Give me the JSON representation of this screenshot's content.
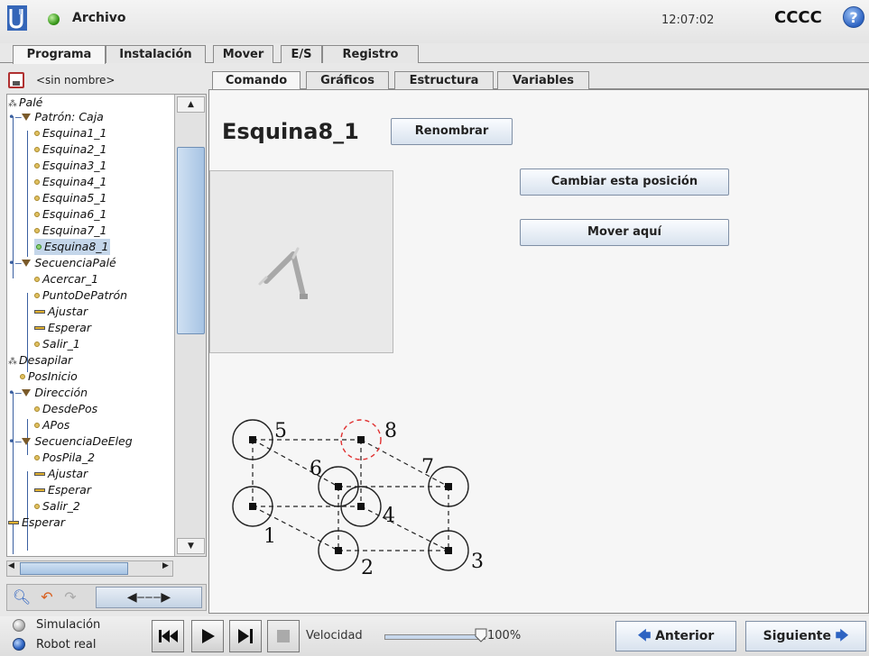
{
  "header": {
    "menu_label": "Archivo",
    "clock": "12:07:02",
    "robot_name": "CCCC",
    "help_label": "?"
  },
  "main_tabs": [
    {
      "label": "Programa",
      "active": true
    },
    {
      "label": "Instalación",
      "active": false
    },
    {
      "label": "Mover",
      "active": false
    },
    {
      "label": "E/S",
      "active": false
    },
    {
      "label": "Registro",
      "active": false
    }
  ],
  "program": {
    "name": "<sin nombre>",
    "tree": [
      {
        "label": "Palé",
        "icon": "pallet-icon"
      },
      {
        "label": "Patrón: Caja",
        "icon": "expand-triangle-icon"
      },
      {
        "label": "Esquina1_1",
        "icon": "waypoint-icon"
      },
      {
        "label": "Esquina2_1",
        "icon": "waypoint-icon"
      },
      {
        "label": "Esquina3_1",
        "icon": "waypoint-icon"
      },
      {
        "label": "Esquina4_1",
        "icon": "waypoint-icon"
      },
      {
        "label": "Esquina5_1",
        "icon": "waypoint-icon"
      },
      {
        "label": "Esquina6_1",
        "icon": "waypoint-icon"
      },
      {
        "label": "Esquina7_1",
        "icon": "waypoint-icon"
      },
      {
        "label": "Esquina8_1",
        "icon": "waypoint-icon",
        "selected": true
      },
      {
        "label": "SecuenciaPalé",
        "icon": "expand-triangle-icon"
      },
      {
        "label": "Acercar_1",
        "icon": "waypoint-icon"
      },
      {
        "label": "PuntoDePatrón",
        "icon": "waypoint-icon"
      },
      {
        "label": "Ajustar",
        "icon": "action-bar-icon"
      },
      {
        "label": "Esperar",
        "icon": "action-bar-icon"
      },
      {
        "label": "Salir_1",
        "icon": "waypoint-icon"
      },
      {
        "label": "Desapilar",
        "icon": "pallet-icon"
      },
      {
        "label": "PosInicio",
        "icon": "waypoint-icon"
      },
      {
        "label": "Dirección",
        "icon": "expand-triangle-icon"
      },
      {
        "label": "DesdePos",
        "icon": "waypoint-icon"
      },
      {
        "label": "APos",
        "icon": "waypoint-icon"
      },
      {
        "label": "SecuenciaDeEleg",
        "icon": "expand-triangle-icon"
      },
      {
        "label": "PosPila_2",
        "icon": "waypoint-icon"
      },
      {
        "label": "Ajustar",
        "icon": "action-bar-icon"
      },
      {
        "label": "Esperar",
        "icon": "action-bar-icon"
      },
      {
        "label": "Salir_2",
        "icon": "waypoint-icon"
      },
      {
        "label": "Esperar",
        "icon": "action-bar-icon"
      }
    ]
  },
  "sub_tabs": [
    {
      "label": "Comando",
      "active": true
    },
    {
      "label": "Gráficos",
      "active": false
    },
    {
      "label": "Estructura",
      "active": false
    },
    {
      "label": "Variables",
      "active": false
    }
  ],
  "command": {
    "title": "Esquina8_1",
    "rename_label": "Renombrar",
    "change_position_label": "Cambiar esta posición",
    "move_here_label": "Mover aquí"
  },
  "pattern": {
    "labels": [
      "5",
      "8",
      "6",
      "7",
      "4",
      "1",
      "2",
      "3"
    ],
    "selected_corner": "8",
    "selected_color": "#e03030"
  },
  "footer": {
    "simulation_label": "Simulación",
    "real_robot_label": "Robot real",
    "speed_label": "Velocidad",
    "speed_value": "100%",
    "speed_fraction": 1.0,
    "prev_label": "Anterior",
    "next_label": "Siguiente"
  },
  "colors": {
    "accent_blue": "#2d63c2",
    "selection": "#c4d6ea",
    "status_green": "#3a9a1c"
  }
}
